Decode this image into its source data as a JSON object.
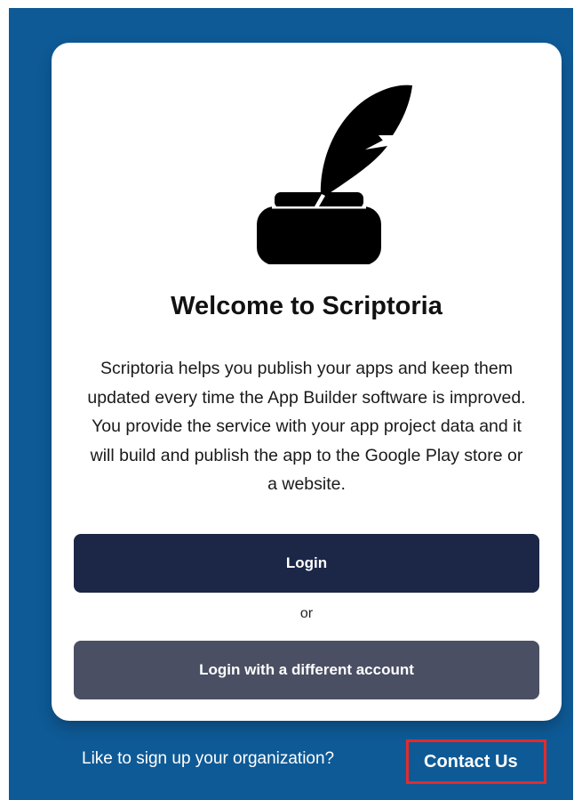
{
  "colors": {
    "background": "#0e5a96",
    "card": "#ffffff",
    "primary_button": "#1c2647",
    "secondary_button": "#4b4f64",
    "highlight_box": "#e32b2b"
  },
  "logo": {
    "icon": "quill-inkwell-icon"
  },
  "welcome": {
    "title": "Welcome to Scriptoria",
    "description": "Scriptoria helps you publish your apps and keep them updated every time the App Builder software is improved. You provide the service with your app project data and it will build and publish the app to the Google Play store or a website."
  },
  "actions": {
    "login_label": "Login",
    "or_label": "or",
    "alt_login_label": "Login with a different account"
  },
  "footer": {
    "signup_text": "Like to sign up your organization?",
    "contact_label": "Contact Us"
  }
}
